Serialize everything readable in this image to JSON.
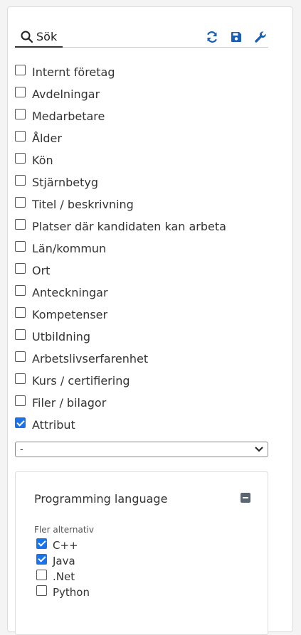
{
  "toolbar": {
    "search_label": "Sök",
    "search_icon": "search-icon",
    "refresh_icon": "refresh-icon",
    "save_icon": "save-icon",
    "settings_icon": "wrench-icon",
    "accent_color": "#1a5fb4"
  },
  "options": [
    {
      "label": "Internt företag",
      "checked": false
    },
    {
      "label": "Avdelningar",
      "checked": false
    },
    {
      "label": "Medarbetare",
      "checked": false
    },
    {
      "label": "Ålder",
      "checked": false
    },
    {
      "label": "Kön",
      "checked": false
    },
    {
      "label": "Stjärnbetyg",
      "checked": false
    },
    {
      "label": "Titel / beskrivning",
      "checked": false
    },
    {
      "label": "Platser där kandidaten kan arbeta",
      "checked": false
    },
    {
      "label": "Län/kommun",
      "checked": false
    },
    {
      "label": "Ort",
      "checked": false
    },
    {
      "label": "Anteckningar",
      "checked": false
    },
    {
      "label": "Kompetenser",
      "checked": false
    },
    {
      "label": "Utbildning",
      "checked": false
    },
    {
      "label": "Arbetslivserfarenhet",
      "checked": false
    },
    {
      "label": "Kurs / certifiering",
      "checked": false
    },
    {
      "label": "Filer / bilagor",
      "checked": false
    },
    {
      "label": "Attribut",
      "checked": true
    }
  ],
  "attribute_select": {
    "value": "-"
  },
  "attribute_group": {
    "title": "Programming language",
    "sub_label": "Fler alternativ",
    "items": [
      {
        "label": "C++",
        "checked": true
      },
      {
        "label": "Java",
        "checked": true
      },
      {
        "label": ".Net",
        "checked": false
      },
      {
        "label": "Python",
        "checked": false
      }
    ]
  },
  "colors": {
    "checkbox_checked": "#1a73e8",
    "icon_blue": "#1a5fb4",
    "collapse_button": "#5a6672"
  }
}
